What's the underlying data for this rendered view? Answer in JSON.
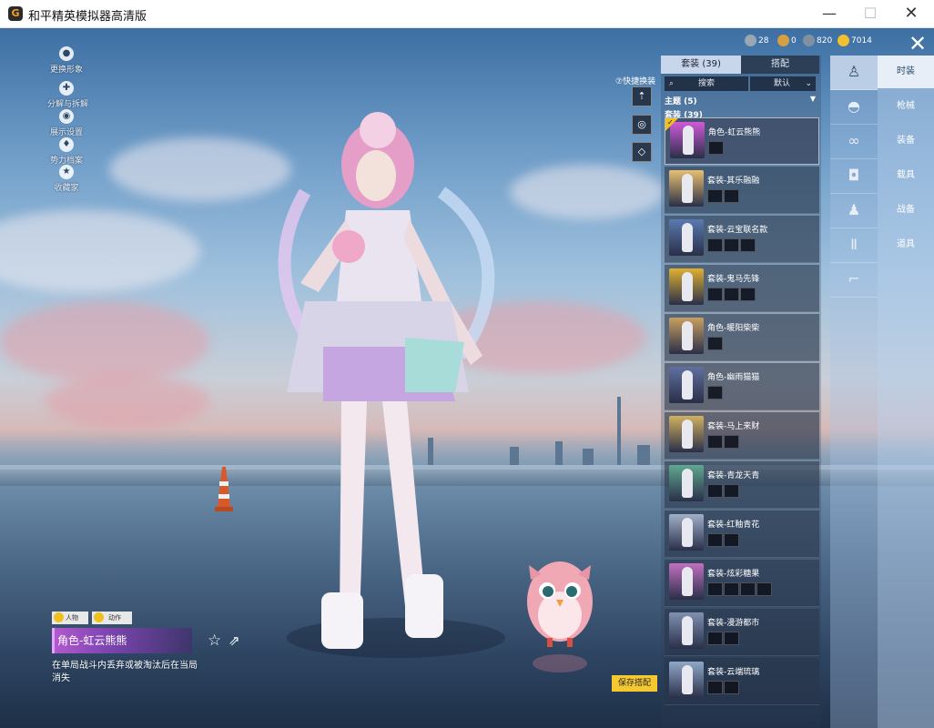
{
  "window": {
    "title": "和平精英模拟器高清版",
    "logo": "G",
    "min": "—",
    "max": "☐",
    "close": "✕"
  },
  "left_menu": [
    {
      "icon": "avatar-icon",
      "glyph": "●",
      "label": "更换形象"
    },
    {
      "icon": "puzzle-icon",
      "glyph": "✚",
      "label": "分解与拆解"
    },
    {
      "icon": "eye-icon",
      "glyph": "◉",
      "label": "展示设置"
    },
    {
      "icon": "pose-icon",
      "glyph": "♦",
      "label": "势力档案"
    },
    {
      "icon": "badge-icon",
      "glyph": "★",
      "label": "收藏家"
    }
  ],
  "quick_switch": {
    "label": "⑦快捷换装",
    "buttons": [
      "⇡",
      "◎",
      "◇"
    ]
  },
  "currency": [
    {
      "icon": "coin-dark-icon",
      "color": "#9aa6b4",
      "value": "28"
    },
    {
      "icon": "coin-gold-icon",
      "color": "#d4a040",
      "value": "0"
    },
    {
      "icon": "coin-silver-icon",
      "color": "#8090a0",
      "value": "820"
    },
    {
      "icon": "coin-yellow-icon",
      "color": "#f0c030",
      "value": "7014"
    }
  ],
  "panel": {
    "tab_suits": "套装 (39)",
    "tab_match": "搭配",
    "search_placeholder": "搜索",
    "sort_label": "默认",
    "theme_row": "主题 (5)",
    "suit_count": "套装 (39)",
    "save_label": "保存搭配"
  },
  "suits": [
    {
      "name": "角色-虹云熊熊",
      "selected": true,
      "thumb": "#d05ad8",
      "minis": 1
    },
    {
      "name": "套装-其乐融融",
      "selected": false,
      "thumb": "#e8c070",
      "minis": 2
    },
    {
      "name": "套装-云宝联名款",
      "selected": false,
      "thumb": "#5a7ab0",
      "minis": 3
    },
    {
      "name": "套装-鬼马先锋",
      "selected": false,
      "thumb": "#e0b030",
      "minis": 3
    },
    {
      "name": "角色-暖阳柴柴",
      "selected": false,
      "thumb": "#c8a060",
      "minis": 1
    },
    {
      "name": "角色-幽雨猫猫",
      "selected": false,
      "thumb": "#6070a0",
      "minis": 1
    },
    {
      "name": "套装-马上来财",
      "selected": false,
      "thumb": "#d0b060",
      "minis": 2
    },
    {
      "name": "套装-青龙天青",
      "selected": false,
      "thumb": "#60a890",
      "minis": 2
    },
    {
      "name": "套装-红釉青花",
      "selected": false,
      "thumb": "#a0b0c8",
      "minis": 2
    },
    {
      "name": "套装-炫彩糖果",
      "selected": false,
      "thumb": "#c070c0",
      "minis": 4
    },
    {
      "name": "套装-漫游都市",
      "selected": false,
      "thumb": "#8090b0",
      "minis": 2
    },
    {
      "name": "套装-云端琉璃",
      "selected": false,
      "thumb": "#90a8c8",
      "minis": 2
    }
  ],
  "category_icons": [
    {
      "name": "outfit-icon",
      "glyph": "♙",
      "selected": true
    },
    {
      "name": "hat-icon",
      "glyph": "◓",
      "selected": false
    },
    {
      "name": "glasses-icon",
      "glyph": "∞",
      "selected": false
    },
    {
      "name": "mask-icon",
      "glyph": "◘",
      "selected": false
    },
    {
      "name": "top-icon",
      "glyph": "♟",
      "selected": false
    },
    {
      "name": "pants-icon",
      "glyph": "Ⅱ",
      "selected": false
    },
    {
      "name": "shoes-icon",
      "glyph": "⌐",
      "selected": false
    }
  ],
  "right_tabs": [
    {
      "label": "时装",
      "selected": true
    },
    {
      "label": "枪械",
      "selected": false
    },
    {
      "label": "装备",
      "selected": false
    },
    {
      "label": "载具",
      "selected": false
    },
    {
      "label": "战备",
      "selected": false
    },
    {
      "label": "道具",
      "selected": false
    }
  ],
  "item_info": {
    "tag_person": "人物",
    "tag_action": "动作",
    "name": "角色-虹云熊熊",
    "description": "在单局战斗内丢弃或被淘汰后在当局消失"
  }
}
